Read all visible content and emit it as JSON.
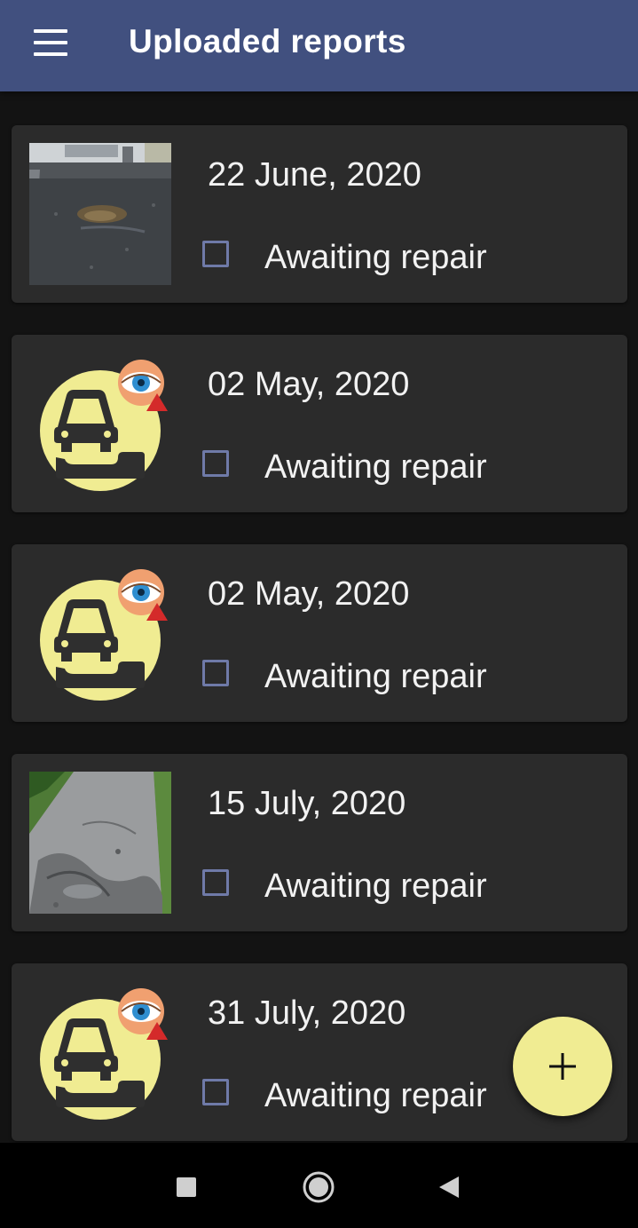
{
  "app_bar": {
    "title": "Uploaded reports",
    "menu_icon": "hamburger-menu-icon"
  },
  "reports": [
    {
      "date": "22 June, 2020",
      "status": "Awaiting repair",
      "checked": false,
      "thumbnail": "photo-pothole-street"
    },
    {
      "date": "02 May, 2020",
      "status": "Awaiting repair",
      "checked": false,
      "thumbnail": "car-pothole-icon"
    },
    {
      "date": "02 May, 2020",
      "status": "Awaiting repair",
      "checked": false,
      "thumbnail": "car-pothole-icon"
    },
    {
      "date": "15 July, 2020",
      "status": "Awaiting repair",
      "checked": false,
      "thumbnail": "photo-damaged-road"
    },
    {
      "date": "31 July, 2020",
      "status": "Awaiting repair",
      "checked": false,
      "thumbnail": "car-pothole-icon"
    }
  ],
  "fab": {
    "icon": "plus-icon"
  },
  "system_nav": {
    "recent_icon": "square-icon",
    "home_icon": "circle-icon",
    "back_icon": "triangle-back-icon"
  },
  "colors": {
    "app_bar": "#41507f",
    "background": "#131313",
    "card": "#2b2b2b",
    "accent_yellow": "#f0ec92",
    "checkbox_border": "#6f7aa8"
  }
}
